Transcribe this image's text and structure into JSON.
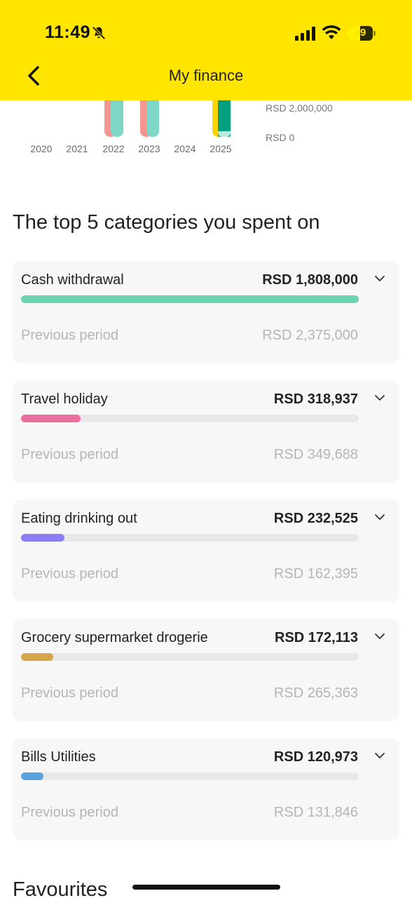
{
  "status_bar": {
    "time": "11:49",
    "battery": "49",
    "battery_level": 0.49
  },
  "header": {
    "title": "My finance"
  },
  "chart_data": {
    "type": "bar",
    "categories": [
      "2020",
      "2021",
      "2022",
      "2023",
      "2024",
      "2025"
    ],
    "y_tick_labels": [
      "RSD 2,000,000",
      "RSD 0"
    ],
    "y_ticks": [
      2000000,
      0
    ],
    "colors": {
      "2022": [
        "#f4968f",
        "#7fd6c8"
      ],
      "2023": [
        "#f4968f",
        "#7fd6c8"
      ],
      "2025": [
        "#ffd400",
        "#009f7f"
      ]
    }
  },
  "top_categories": {
    "title": "The top 5 categories you spent on",
    "items": [
      {
        "name": "Cash withdrawal",
        "amount": "RSD 1,808,000",
        "share": 1.0,
        "color": "#6dd4b1",
        "prev_label": "Previous period",
        "prev_amount": "RSD 2,375,000"
      },
      {
        "name": "Travel holiday",
        "amount": "RSD 318,937",
        "share": 0.176,
        "color": "#ec6fa1",
        "prev_label": "Previous period",
        "prev_amount": "RSD 349,688"
      },
      {
        "name": "Eating drinking out",
        "amount": "RSD 232,525",
        "share": 0.129,
        "color": "#8a7df5",
        "prev_label": "Previous period",
        "prev_amount": "RSD 162,395"
      },
      {
        "name": "Grocery supermarket drogerie",
        "amount": "RSD 172,113",
        "share": 0.095,
        "color": "#d7a44b",
        "prev_label": "Previous period",
        "prev_amount": "RSD 265,363"
      },
      {
        "name": "Bills Utilities",
        "amount": "RSD 120,973",
        "share": 0.067,
        "color": "#5aa1e0",
        "prev_label": "Previous period",
        "prev_amount": "RSD 131,846"
      }
    ]
  },
  "favourites": {
    "title": "Favourites"
  }
}
